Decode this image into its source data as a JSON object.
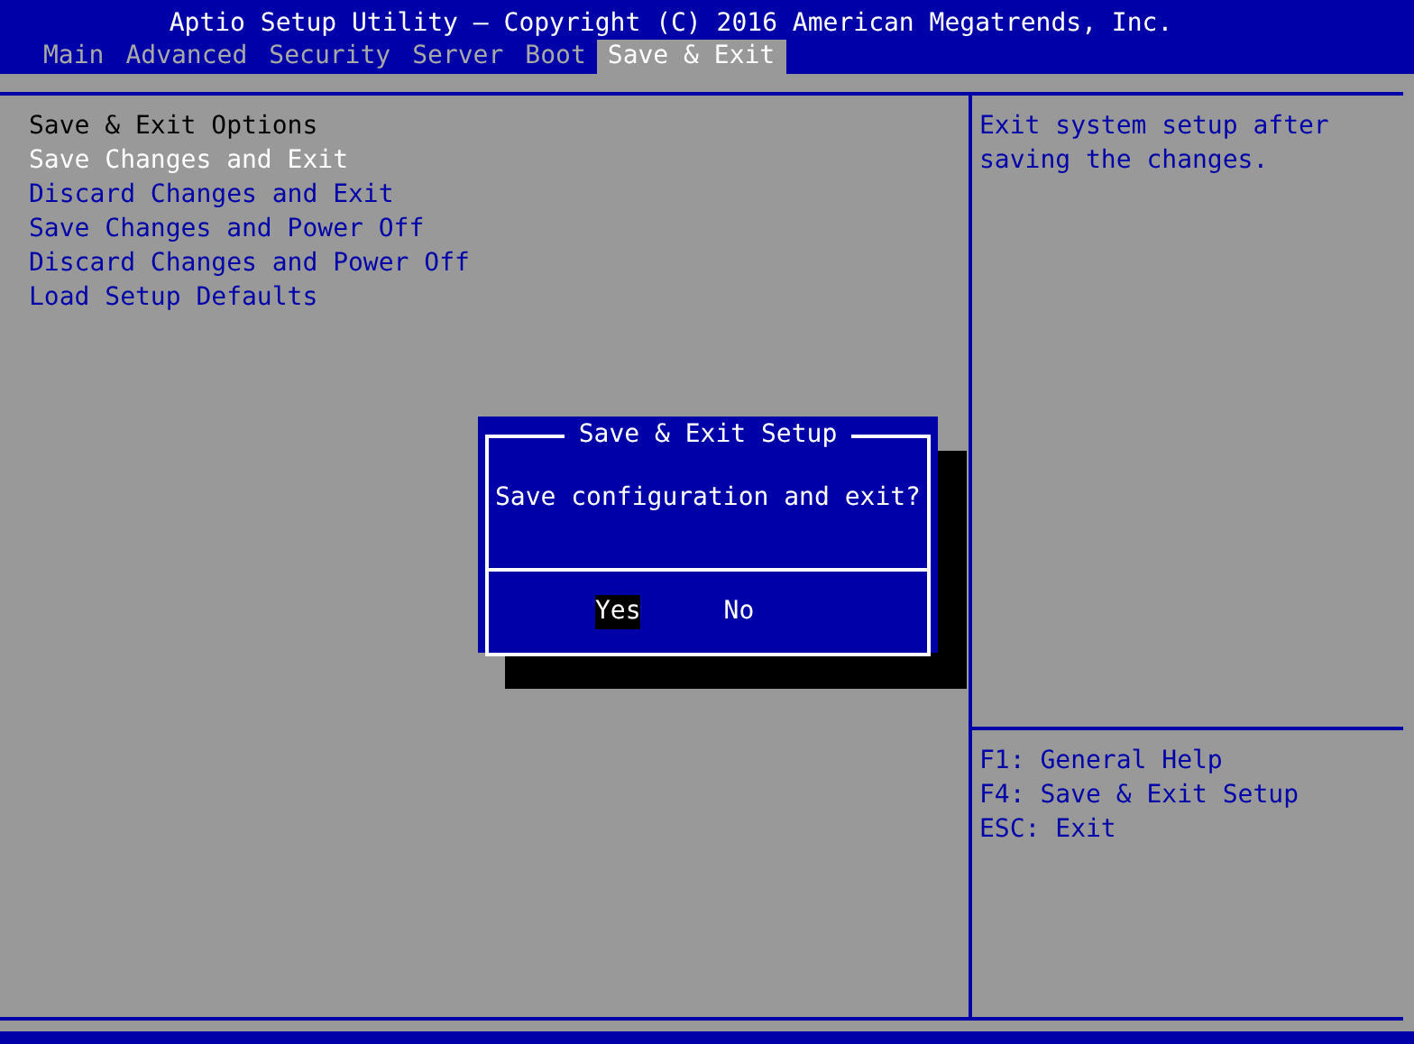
{
  "title": "Aptio Setup Utility – Copyright (C) 2016 American Megatrends, Inc.",
  "tabs": [
    {
      "label": "Main",
      "selected": false
    },
    {
      "label": "Advanced",
      "selected": false
    },
    {
      "label": "Security",
      "selected": false
    },
    {
      "label": "Server",
      "selected": false
    },
    {
      "label": "Boot",
      "selected": false
    },
    {
      "label": "Save & Exit",
      "selected": true
    }
  ],
  "menu": [
    {
      "kind": "header",
      "label": "Save & Exit Options"
    },
    {
      "kind": "item",
      "label": "Save Changes and Exit",
      "selected": true
    },
    {
      "kind": "item",
      "label": "Discard Changes and Exit",
      "selected": false
    },
    {
      "kind": "item",
      "label": "Save Changes and Power Off",
      "selected": false
    },
    {
      "kind": "item",
      "label": "Discard Changes and Power Off",
      "selected": false
    },
    {
      "kind": "item",
      "label": "Load Setup Defaults",
      "selected": false
    }
  ],
  "help_text": "Exit system setup after saving the changes.",
  "key_help": [
    "F1: General Help",
    "F4: Save & Exit Setup",
    "ESC: Exit"
  ],
  "dialog": {
    "title": "Save & Exit Setup",
    "message": "Save configuration and exit?",
    "buttons": [
      {
        "label": "Yes",
        "selected": true
      },
      {
        "label": "No",
        "selected": false
      }
    ]
  }
}
